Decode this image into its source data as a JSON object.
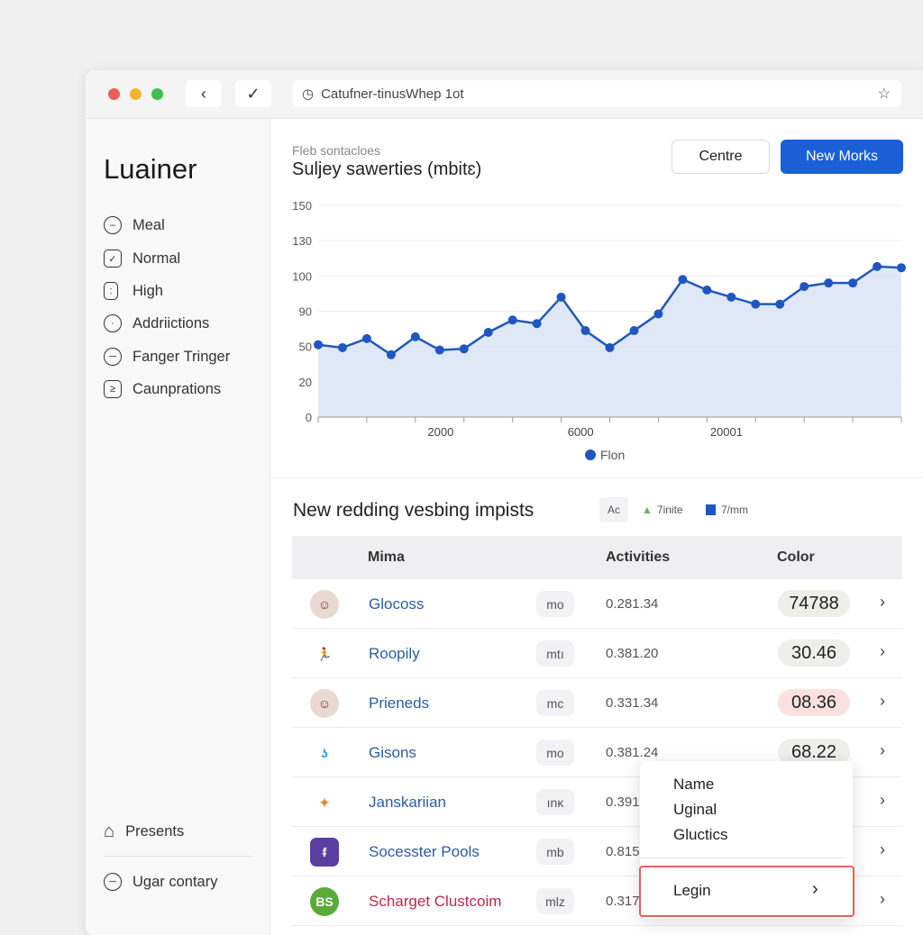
{
  "browser": {
    "url": "Catufner-tinusWhep 1ot",
    "back_icon": "chevron-left",
    "forward_icon": "check",
    "star_icon": "star",
    "dots": [
      "#ec5f57",
      "#f4b532",
      "#41be4c"
    ]
  },
  "sidebar": {
    "brand": "Luainer",
    "items": [
      {
        "label": "Meal",
        "icon": "minus-circle"
      },
      {
        "label": "Normal",
        "icon": "checkbox"
      },
      {
        "label": "High",
        "icon": "device"
      },
      {
        "label": "Addriictions",
        "icon": "dot-circle"
      },
      {
        "label": "Fanger Tringer",
        "icon": "striped-circle"
      },
      {
        "label": "Caunprations",
        "icon": "terminal"
      }
    ],
    "bottom": [
      {
        "label": "Presents",
        "icon": "home"
      },
      {
        "label": "Ugar contary",
        "icon": "striped-circle"
      }
    ]
  },
  "header": {
    "subtitle": "Fleb sontacloes",
    "title": "Suljey sawerties (mbitɛ)",
    "secondary_button": "Centre",
    "primary_button": "New Morks",
    "accent": "#1a5fd6"
  },
  "chart_data": {
    "type": "area",
    "title": "Suljey sawerties (mbitɛ)",
    "y_tick_labels": [
      "0",
      "20",
      "50",
      "90",
      "100",
      "130",
      "150"
    ],
    "x_tick_labels": [
      "2000",
      "6000",
      "20001"
    ],
    "grid": true,
    "legend_position": "bottom",
    "series": [
      {
        "name": "Flon",
        "color": "#1f57c2",
        "values": [
          52,
          49,
          59,
          43,
          61,
          47,
          48,
          66,
          80,
          76,
          94,
          68,
          49,
          68,
          87,
          99,
          96,
          94,
          92,
          92,
          97,
          98,
          98,
          108,
          107
        ]
      }
    ]
  },
  "table": {
    "title": "New redding vesbing impists",
    "legend": [
      {
        "label": "Ac"
      },
      {
        "label": "7inite",
        "color": "#5cb85c"
      },
      {
        "label": "7/mm",
        "color": "#1f57c2"
      }
    ],
    "columns": [
      "Mima",
      "Activities",
      "Color"
    ],
    "rows": [
      {
        "name": "Glocoss",
        "badge": "mo",
        "activity": "0.281.34",
        "color": "74788",
        "avatar": "person"
      },
      {
        "name": "Roopily",
        "badge": "mtı",
        "activity": "0.381.20",
        "color": "30.46",
        "avatar": "figure"
      },
      {
        "name": "Prieneds",
        "badge": "mc",
        "activity": "0.331.34",
        "color": "08.36",
        "avatar": "person",
        "pill": "#fbe0e0"
      },
      {
        "name": "Gisons",
        "badge": "mo",
        "activity": "0.381.24",
        "color": "68.22",
        "avatar": "hook"
      },
      {
        "name": "Janskariian",
        "badge": "ınĸ",
        "activity": "0.391",
        "color": "",
        "avatar": "rocket"
      },
      {
        "name": "Socesster Pools",
        "badge": "mb",
        "activity": "0.815",
        "color": "",
        "avatar": "app"
      },
      {
        "name": "Scharget Clustcoim",
        "badge": "mlz",
        "activity": "0.317",
        "color": "",
        "avatar": "BS",
        "name_color": "#c0264a"
      }
    ]
  },
  "menu": {
    "items": [
      "Name",
      "Uginal",
      "Gluctics"
    ],
    "action": "Legin"
  }
}
